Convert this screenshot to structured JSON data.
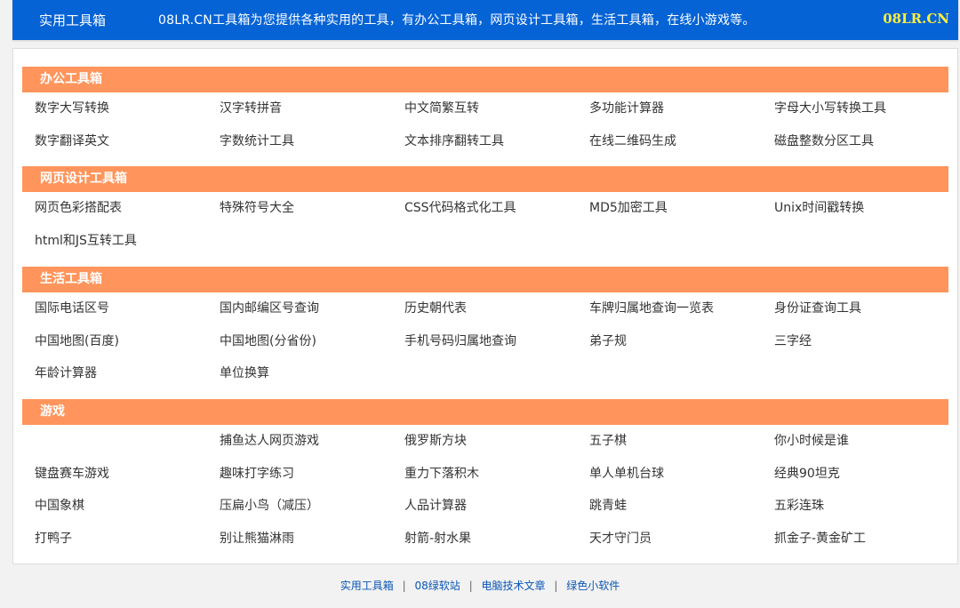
{
  "header": {
    "brand": "实用工具箱",
    "description": "08LR.CN工具箱为您提供各种实用的工具，有办公工具箱，网页设计工具箱，生活工具箱，在线小游戏等。",
    "site": "08LR.CN"
  },
  "sections": [
    {
      "title": "办公工具箱",
      "items": [
        "数字大写转换",
        "汉字转拼音",
        "中文简繁互转",
        "多功能计算器",
        "字母大小写转换工具",
        "数字翻译英文",
        "字数统计工具",
        "文本排序翻转工具",
        "在线二维码生成",
        "磁盘整数分区工具"
      ]
    },
    {
      "title": "网页设计工具箱",
      "items": [
        "网页色彩搭配表",
        "特殊符号大全",
        "CSS代码格式化工具",
        "MD5加密工具",
        "Unix时间戳转换",
        "html和JS互转工具"
      ]
    },
    {
      "title": "生活工具箱",
      "items": [
        "国际电话区号",
        "国内邮编区号查询",
        "历史朝代表",
        "车牌归属地查询一览表",
        "身份证查询工具",
        "中国地图(百度)",
        "中国地图(分省份)",
        "手机号码归属地查询",
        "弟子规",
        "三字经",
        "年龄计算器",
        "单位换算"
      ]
    },
    {
      "title": "游戏",
      "items": [
        "",
        "捕鱼达人网页游戏",
        "俄罗斯方块",
        "五子棋",
        "你小时候是谁",
        "键盘赛车游戏",
        "趣味打字练习",
        "重力下落积木",
        "单人单机台球",
        "经典90坦克",
        "中国象棋",
        "压扁小鸟（减压）",
        "人品计算器",
        "跳青蛙",
        "五彩连珠",
        "打鸭子",
        "别让熊猫淋雨",
        "射箭-射水果",
        "天才守门员",
        "抓金子-黄金矿工"
      ]
    }
  ],
  "footer": {
    "links": [
      "实用工具箱",
      "08绿软站",
      "电脑技术文章",
      "绿色小软件"
    ],
    "separator": "|"
  }
}
